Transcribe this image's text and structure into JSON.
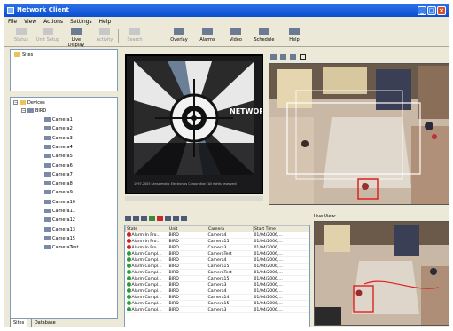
{
  "window": {
    "title": "Network Client"
  },
  "menu": [
    "File",
    "View",
    "Actions",
    "Settings",
    "Help"
  ],
  "toolbar": {
    "left": [
      {
        "label": "Status",
        "enabled": false
      },
      {
        "label": "Unit Setup",
        "enabled": false
      },
      {
        "label": "Live Display",
        "enabled": true
      },
      {
        "label": "Activity",
        "enabled": false
      },
      {
        "label": "Search",
        "enabled": false
      }
    ],
    "right": [
      {
        "label": "Overlay"
      },
      {
        "label": "Alarms"
      },
      {
        "label": "Video"
      },
      {
        "label": "Schedule"
      },
      {
        "label": "Help"
      }
    ]
  },
  "sites_panel": {
    "root": "Sites"
  },
  "tree": {
    "devices": "Devices",
    "unit": "BIRD",
    "cameras": [
      "Camera1",
      "Camera2",
      "Camera3",
      "Camera4",
      "Camera5",
      "Camera6",
      "Camera7",
      "Camera8",
      "Camera9",
      "Camera10",
      "Camera11",
      "Camera12",
      "Camera13",
      "Camera15",
      "CameraTest"
    ]
  },
  "bottom_tabs": [
    "Sites",
    "Database"
  ],
  "video1": {
    "watermark": "NETWOR",
    "copyright": "1997-2005 Sensormatic Electronics Corporation (All rights reserved)"
  },
  "live_view_label": "Live View:",
  "alarm_table": {
    "columns": [
      "State",
      "Unit",
      "Camera",
      "Start Time"
    ],
    "rows": [
      {
        "state": "Alarm In Pro...",
        "unit": "BIRD",
        "camera": "Camera4",
        "time": "01/04/2006,...",
        "color": "red"
      },
      {
        "state": "Alarm In Pro...",
        "unit": "BIRD",
        "camera": "Camera15",
        "time": "01/04/2006,...",
        "color": "red"
      },
      {
        "state": "Alarm In Pro...",
        "unit": "BIRD",
        "camera": "Camera3",
        "time": "01/04/2006,...",
        "color": "red"
      },
      {
        "state": "Alarm Compl...",
        "unit": "BIRD",
        "camera": "CameraTest",
        "time": "01/04/2006,...",
        "color": "grn"
      },
      {
        "state": "Alarm Compl...",
        "unit": "BIRD",
        "camera": "Camera4",
        "time": "01/04/2006,...",
        "color": "grn"
      },
      {
        "state": "Alarm Compl...",
        "unit": "BIRD",
        "camera": "Camera15",
        "time": "01/04/2006,...",
        "color": "grn"
      },
      {
        "state": "Alarm Compl...",
        "unit": "BIRD",
        "camera": "CameraTest",
        "time": "01/04/2006,...",
        "color": "grn"
      },
      {
        "state": "Alarm Compl...",
        "unit": "BIRD",
        "camera": "Camera15",
        "time": "01/04/2006,...",
        "color": "grn"
      },
      {
        "state": "Alarm Compl...",
        "unit": "BIRD",
        "camera": "Camera3",
        "time": "01/04/2006,...",
        "color": "grn"
      },
      {
        "state": "Alarm Compl...",
        "unit": "BIRD",
        "camera": "Camera4",
        "time": "01/04/2006,...",
        "color": "grn"
      },
      {
        "state": "Alarm Compl...",
        "unit": "BIRD",
        "camera": "Camera14",
        "time": "01/04/2006,...",
        "color": "grn"
      },
      {
        "state": "Alarm Compl...",
        "unit": "BIRD",
        "camera": "Camera15",
        "time": "01/04/2006,...",
        "color": "grn"
      },
      {
        "state": "Alarm Compl...",
        "unit": "BIRD",
        "camera": "Camera3",
        "time": "01/04/2006,...",
        "color": "grn"
      }
    ]
  },
  "colors": {
    "titlebar": "#0a4fd0",
    "alarm_red": "#d02020",
    "alarm_green": "#2f9a3a"
  }
}
